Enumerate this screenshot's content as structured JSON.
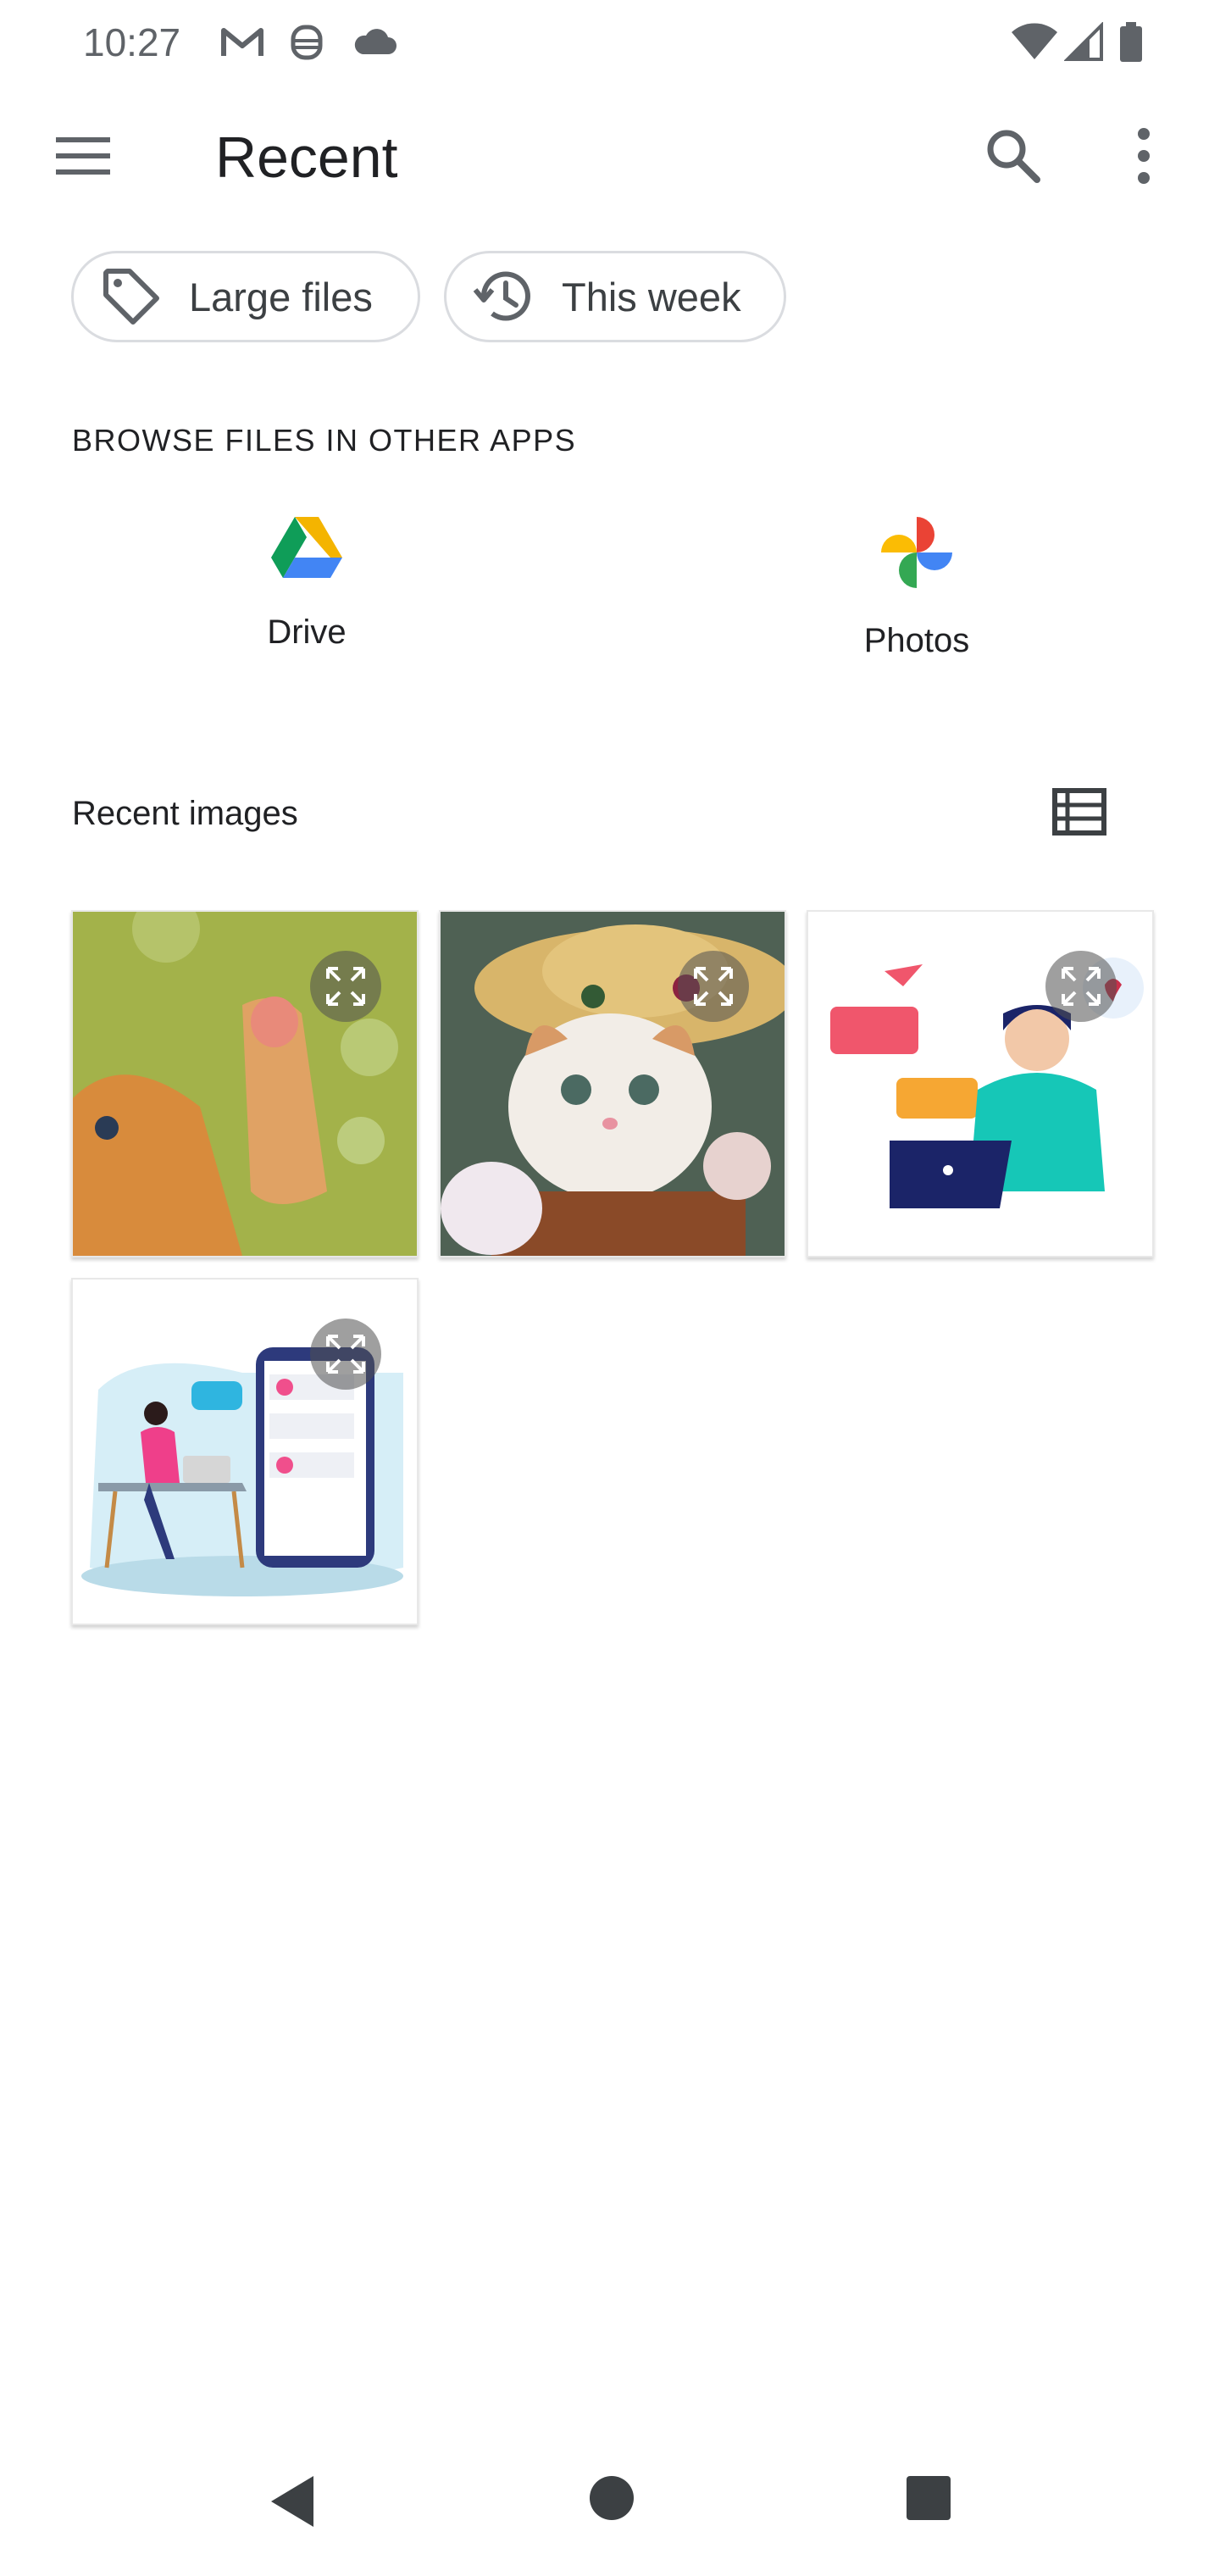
{
  "status_bar": {
    "time": "10:27",
    "left_icons": [
      "gmail-icon",
      "android-debug-icon",
      "cloud-icon"
    ],
    "right_icons": [
      "wifi-icon",
      "signal-icon",
      "battery-icon"
    ]
  },
  "app_bar": {
    "title": "Recent",
    "menu_icon": "hamburger-menu-icon",
    "search_icon": "search-icon",
    "overflow_icon": "more-vert-icon"
  },
  "filter_chips": [
    {
      "label": "Large files",
      "icon": "tag-icon"
    },
    {
      "label": "This week",
      "icon": "history-icon"
    }
  ],
  "browse_section": {
    "heading": "BROWSE FILES IN OTHER APPS",
    "apps": [
      {
        "label": "Drive",
        "icon": "google-drive-icon"
      },
      {
        "label": "Photos",
        "icon": "google-photos-icon"
      }
    ]
  },
  "recent_images": {
    "heading": "Recent images",
    "view_toggle_icon": "list-view-icon",
    "items": [
      {
        "name": "kitten-bubbles-thumbnail"
      },
      {
        "name": "kitten-hat-thumbnail"
      },
      {
        "name": "chat-illustration-thumbnail"
      },
      {
        "name": "desk-illustration-thumbnail"
      }
    ]
  },
  "nav_bar": {
    "back_icon": "back-icon",
    "home_icon": "home-icon",
    "recents_icon": "recents-icon"
  },
  "colors": {
    "primary_text": "#202124",
    "secondary_text": "#5f6368",
    "chip_border": "#dadce0",
    "drive_green": "#0f9d58",
    "drive_yellow": "#f4b400",
    "drive_blue": "#4285f4"
  }
}
